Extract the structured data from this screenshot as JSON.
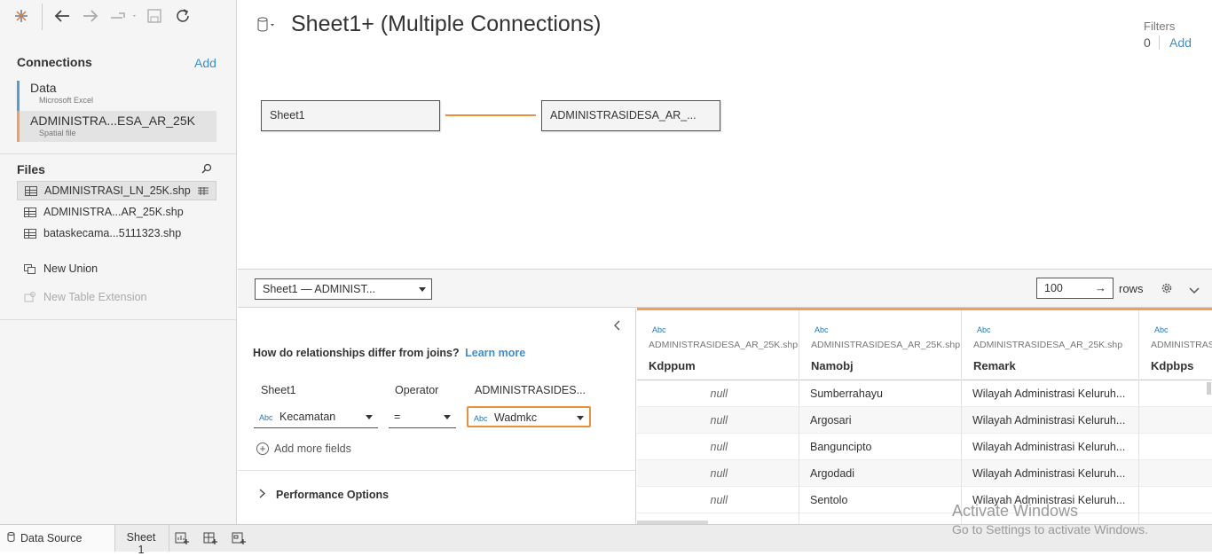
{
  "toolbar": {
    "icons": [
      "tableau-logo-icon",
      "back-icon",
      "forward-icon",
      "redo-icon",
      "save-icon",
      "refresh-icon"
    ]
  },
  "connections": {
    "title": "Connections",
    "add_label": "Add",
    "items": [
      {
        "name": "Data",
        "type": "Microsoft Excel",
        "accent": "#4f9fd6"
      },
      {
        "name": "ADMINISTRA...ESA_AR_25K",
        "type": "Spatial file",
        "accent": "#f0a05a"
      }
    ]
  },
  "files": {
    "title": "Files",
    "items": [
      "ADMINISTRASI_LN_25K.shp",
      "ADMINISTRA...AR_25K.shp",
      "bataskecama...5111323.shp"
    ],
    "new_union": "New Union",
    "new_table_extension": "New Table Extension"
  },
  "canvas": {
    "title": "Sheet1+ (Multiple Connections)",
    "filters_label": "Filters",
    "filters_count": "0",
    "filters_add": "Add",
    "left_table": "Sheet1",
    "right_table": "ADMINISTRASIDESA_AR_..."
  },
  "midbar": {
    "relationship_select": "Sheet1  —  ADMINIST...",
    "rows_value": "100",
    "rows_label": "rows"
  },
  "relationship": {
    "question": "How do relationships differ from joins?",
    "learn_more": "Learn more",
    "col_left_header": "Sheet1",
    "col_op_header": "Operator",
    "col_right_header": "ADMINISTRASIDES...",
    "left_field": "Kecamatan",
    "operator": "=",
    "right_field": "Wadmkc",
    "abc": "Abc",
    "add_more": "Add more fields",
    "performance": "Performance Options"
  },
  "grid": {
    "columns": [
      {
        "type": "Abc",
        "source": "ADMINISTRASIDESA_AR_25K.shp",
        "name": "Kdppum"
      },
      {
        "type": "Abc",
        "source": "ADMINISTRASIDESA_AR_25K.shp",
        "name": "Namobj"
      },
      {
        "type": "Abc",
        "source": "ADMINISTRASIDESA_AR_25K.shp",
        "name": "Remark"
      },
      {
        "type": "Abc",
        "source": "ADMINISTRASI",
        "name": "Kdpbps"
      }
    ],
    "rows": [
      [
        "null",
        "Sumberrahayu",
        "Wilayah Administrasi Keluruh...",
        ""
      ],
      [
        "null",
        "Argosari",
        "Wilayah Administrasi Keluruh...",
        ""
      ],
      [
        "null",
        "Banguncipto",
        "Wilayah Administrasi Keluruh...",
        ""
      ],
      [
        "null",
        "Argodadi",
        "Wilayah Administrasi Keluruh...",
        ""
      ],
      [
        "null",
        "Sentolo",
        "Wilayah Administrasi Keluruh...",
        ""
      ]
    ]
  },
  "bottom": {
    "data_source": "Data Source",
    "sheet1": "Sheet 1"
  },
  "watermark": {
    "line1": "Activate Windows",
    "line2": "Go to Settings to activate Windows."
  },
  "colors": {
    "accent_blue": "#3c8ed0",
    "relationship_orange": "#e8913a"
  }
}
